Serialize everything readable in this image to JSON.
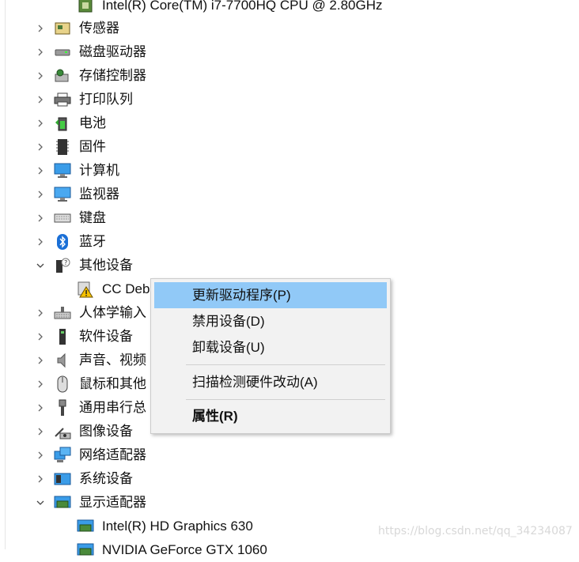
{
  "tree": {
    "cpu_item": "Intel(R) Core(TM) i7-7700HQ CPU @ 2.80GHz",
    "categories": [
      {
        "label": "传感器",
        "icon": "sensor-icon"
      },
      {
        "label": "磁盘驱动器",
        "icon": "disk-drive-icon"
      },
      {
        "label": "存储控制器",
        "icon": "storage-controller-icon"
      },
      {
        "label": "打印队列",
        "icon": "printer-icon"
      },
      {
        "label": "电池",
        "icon": "battery-icon"
      },
      {
        "label": "固件",
        "icon": "firmware-icon"
      },
      {
        "label": "计算机",
        "icon": "computer-icon"
      },
      {
        "label": "监视器",
        "icon": "monitor-icon"
      },
      {
        "label": "键盘",
        "icon": "keyboard-icon"
      },
      {
        "label": "蓝牙",
        "icon": "bluetooth-icon"
      },
      {
        "label": "其他设备",
        "icon": "other-devices-icon"
      },
      {
        "label": "CC Deb",
        "icon": "unknown-device-warning-icon"
      },
      {
        "label": "人体学输入",
        "icon": "hid-icon"
      },
      {
        "label": "软件设备",
        "icon": "software-device-icon"
      },
      {
        "label": "声音、视频",
        "icon": "audio-icon"
      },
      {
        "label": "鼠标和其他",
        "icon": "mouse-icon"
      },
      {
        "label": "通用串行总",
        "icon": "usb-icon"
      },
      {
        "label": "图像设备",
        "icon": "camera-icon"
      },
      {
        "label": "网络适配器",
        "icon": "network-adapter-icon"
      },
      {
        "label": "系统设备",
        "icon": "system-device-icon"
      },
      {
        "label": "显示适配器",
        "icon": "display-adapter-icon"
      },
      {
        "label": "Intel(R) HD Graphics 630",
        "icon": "display-adapter-icon"
      },
      {
        "label": "NVIDIA GeForce GTX 1060",
        "icon": "display-adapter-icon"
      }
    ]
  },
  "context_menu": {
    "update_driver": "更新驱动程序(P)",
    "disable_device": "禁用设备(D)",
    "uninstall_device": "卸载设备(U)",
    "scan_hardware": "扫描检测硬件改动(A)",
    "properties": "属性(R)"
  },
  "watermark": "https://blog.csdn.net/qq_34234087",
  "colors": {
    "highlight": "#91c9f7",
    "menu_bg": "#f2f2f2"
  }
}
